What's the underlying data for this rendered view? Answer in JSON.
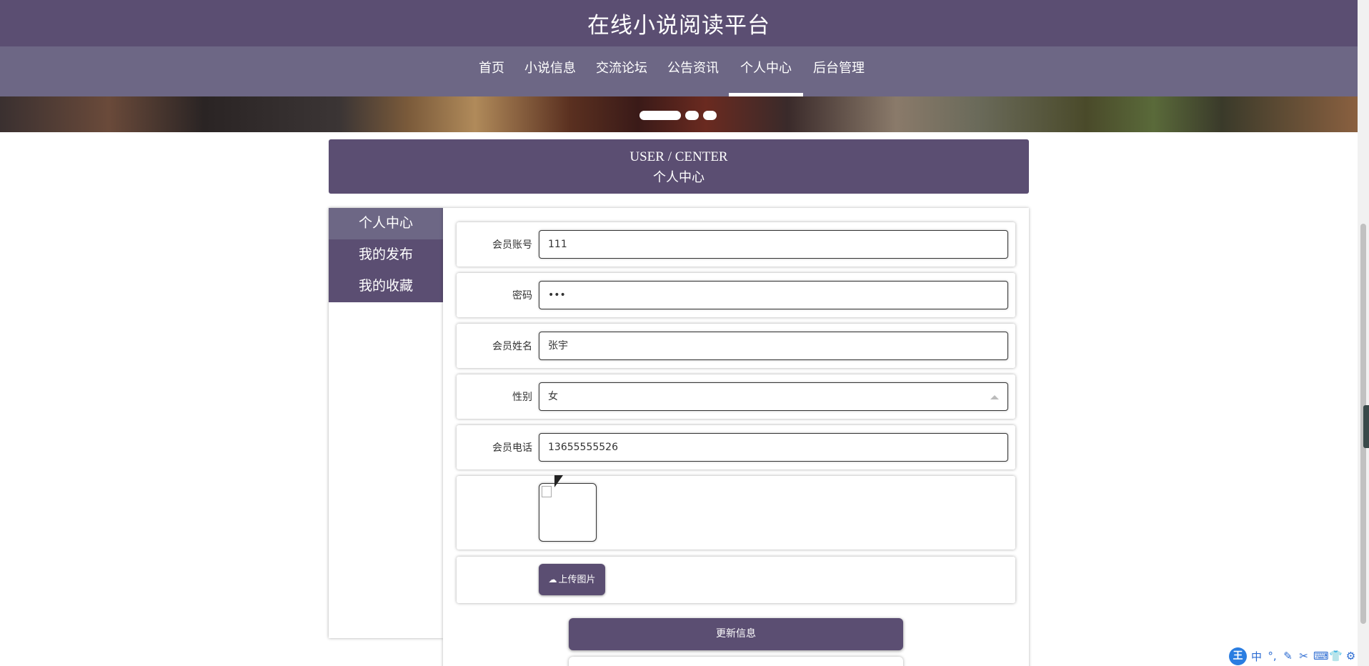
{
  "header": {
    "title": "在线小说阅读平台"
  },
  "nav": {
    "items": [
      {
        "label": "首页"
      },
      {
        "label": "小说信息"
      },
      {
        "label": "交流论坛"
      },
      {
        "label": "公告资讯"
      },
      {
        "label": "个人中心"
      },
      {
        "label": "后台管理"
      }
    ],
    "active": "个人中心"
  },
  "carousel": {
    "slides": 3,
    "active_index": 0
  },
  "section": {
    "title_en": "USER / CENTER",
    "title_cn": "个人中心"
  },
  "sidebar": {
    "items": [
      {
        "label": "个人中心"
      },
      {
        "label": "我的发布"
      },
      {
        "label": "我的收藏"
      }
    ],
    "active": "个人中心"
  },
  "form": {
    "account": {
      "label": "会员账号",
      "value": "111"
    },
    "password": {
      "label": "密码",
      "value": "•••"
    },
    "name": {
      "label": "会员姓名",
      "value": "张宇"
    },
    "gender": {
      "label": "性别",
      "value": "女"
    },
    "phone": {
      "label": "会员电话",
      "value": "13655555526"
    },
    "upload_label": "上传图片",
    "update_label": "更新信息"
  },
  "ime": {
    "logo": "王",
    "icons": [
      "中",
      "°,",
      "✎",
      "✂",
      "⌨",
      "👕",
      "⚙"
    ]
  },
  "colors": {
    "primary": "#5b4e72",
    "nav": "#6d6785"
  }
}
